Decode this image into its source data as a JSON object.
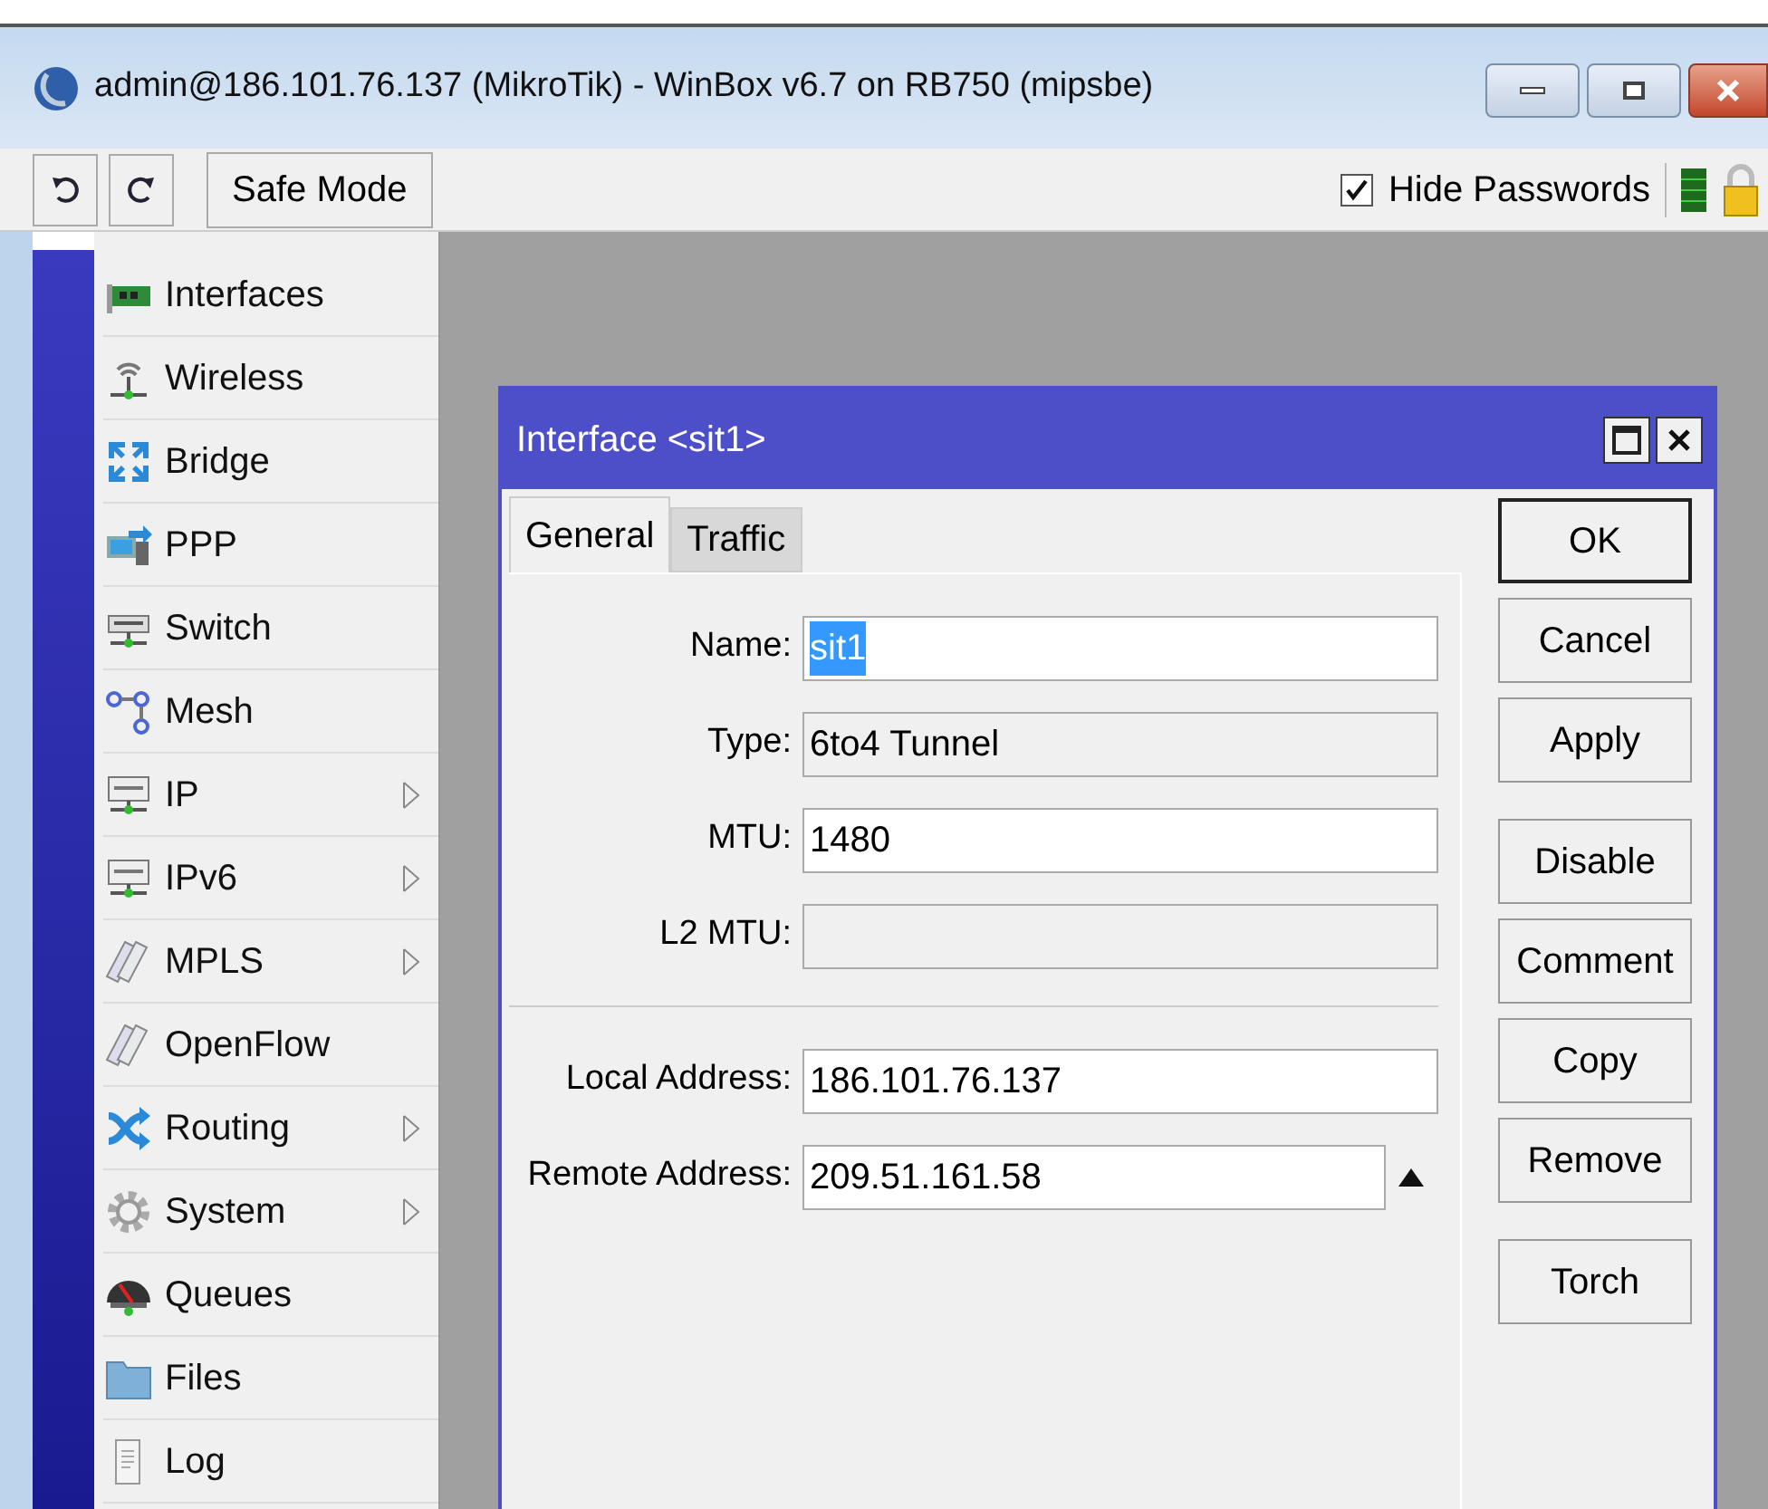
{
  "window": {
    "title": "admin@186.101.76.137 (MikroTik) - WinBox v6.7 on RB750 (mipsbe)"
  },
  "toolbar": {
    "safe_mode": "Safe Mode",
    "hide_passwords": {
      "label": "Hide Passwords",
      "checked": true
    }
  },
  "menu": [
    {
      "label": "Interfaces",
      "submenu": false
    },
    {
      "label": "Wireless",
      "submenu": false
    },
    {
      "label": "Bridge",
      "submenu": false
    },
    {
      "label": "PPP",
      "submenu": false
    },
    {
      "label": "Switch",
      "submenu": false
    },
    {
      "label": "Mesh",
      "submenu": false
    },
    {
      "label": "IP",
      "submenu": true
    },
    {
      "label": "IPv6",
      "submenu": true
    },
    {
      "label": "MPLS",
      "submenu": true
    },
    {
      "label": "OpenFlow",
      "submenu": false
    },
    {
      "label": "Routing",
      "submenu": true
    },
    {
      "label": "System",
      "submenu": true
    },
    {
      "label": "Queues",
      "submenu": false
    },
    {
      "label": "Files",
      "submenu": false
    },
    {
      "label": "Log",
      "submenu": false
    }
  ],
  "dialog": {
    "title": "Interface <sit1>",
    "tabs": [
      {
        "label": "General",
        "selected": true
      },
      {
        "label": "Traffic",
        "selected": false
      }
    ],
    "groups": [
      [
        {
          "label": "Name:",
          "value": "sit1",
          "editable": true,
          "highlighted": true,
          "dropdown": false
        },
        {
          "label": "Type:",
          "value": "6to4 Tunnel",
          "editable": false,
          "highlighted": false,
          "dropdown": false
        },
        {
          "label": "MTU:",
          "value": "1480",
          "editable": true,
          "highlighted": false,
          "dropdown": false
        },
        {
          "label": "L2 MTU:",
          "editable": false,
          "dropdown": false
        }
      ],
      [
        {
          "label": "Local Address:",
          "value": "186.101.76.137",
          "editable": true,
          "highlighted": false,
          "dropdown": false
        },
        {
          "label": "Remote Address:",
          "value": "209.51.161.58",
          "editable": true,
          "highlighted": false,
          "dropdown": true
        }
      ]
    ],
    "button_groups": [
      [
        {
          "label": "OK",
          "default": true
        },
        {
          "label": "Cancel",
          "default": false
        },
        {
          "label": "Apply",
          "default": false
        }
      ],
      [
        {
          "label": "Disable",
          "default": false
        },
        {
          "label": "Comment",
          "default": false
        },
        {
          "label": "Copy",
          "default": false
        },
        {
          "label": "Remove",
          "default": false
        }
      ],
      [
        {
          "label": "Torch",
          "default": false
        }
      ]
    ]
  }
}
